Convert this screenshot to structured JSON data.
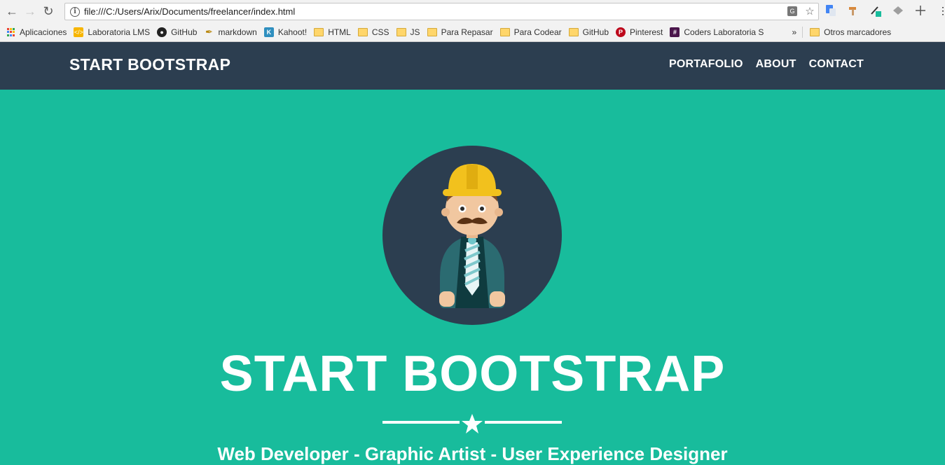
{
  "browser": {
    "url": "file:///C:/Users/Arix/Documents/freelancer/index.html",
    "bookmarks": [
      {
        "label": "Aplicaciones",
        "icon": "apps-grid-icon"
      },
      {
        "label": "Laboratoria LMS",
        "icon": "laboratoria-icon"
      },
      {
        "label": "GitHub",
        "icon": "github-icon"
      },
      {
        "label": "markdown",
        "icon": "markdown-icon"
      },
      {
        "label": "Kahoot!",
        "icon": "kahoot-icon"
      },
      {
        "label": "HTML",
        "icon": "folder-icon"
      },
      {
        "label": "CSS",
        "icon": "folder-icon"
      },
      {
        "label": "JS",
        "icon": "folder-icon"
      },
      {
        "label": "Para Repasar",
        "icon": "folder-icon"
      },
      {
        "label": "Para Codear",
        "icon": "folder-icon"
      },
      {
        "label": "GitHub",
        "icon": "folder-icon"
      },
      {
        "label": "Pinterest",
        "icon": "pinterest-icon"
      },
      {
        "label": "Coders Laboratoria S",
        "icon": "slack-icon"
      }
    ],
    "more_label": "»",
    "other_bookmarks": "Otros marcadores"
  },
  "site": {
    "brand": "START BOOTSTRAP",
    "nav": [
      "PORTAFOLIO",
      "ABOUT",
      "CONTACT"
    ]
  },
  "hero": {
    "title": "START BOOTSTRAP",
    "subtitle": "Web Developer - Graphic Artist - User Experience Designer"
  },
  "colors": {
    "navbar": "#2c3e50",
    "accent": "#18bc9c",
    "text": "#ffffff"
  }
}
